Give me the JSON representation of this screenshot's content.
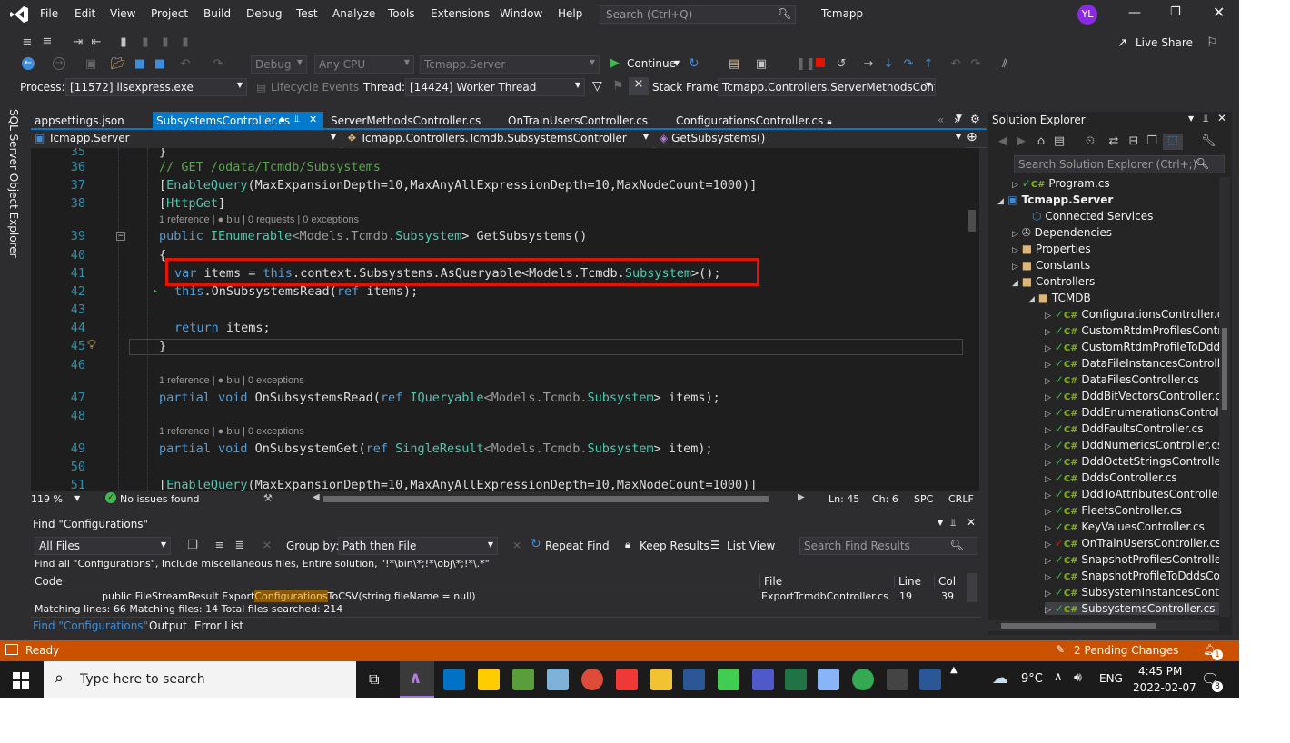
{
  "menu": {
    "items": [
      "File",
      "Edit",
      "View",
      "Project",
      "Build",
      "Debug",
      "Test",
      "Analyze",
      "Tools",
      "Extensions",
      "Window",
      "Help"
    ],
    "search_placeholder": "Search (Ctrl+Q)",
    "solution_name": "Tcmapp",
    "user_initials": "YL",
    "live_share": "Live Share"
  },
  "toolbar": {
    "config": "Debug",
    "platform": "Any CPU",
    "startup": "Tcmapp.Server",
    "continue": "Continue",
    "process_label": "Process:",
    "process": "[11572] iisexpress.exe",
    "lifecycle": "Lifecycle Events",
    "thread_label": "Thread:",
    "thread": "[14424] Worker Thread",
    "stackframe_label": "Stack Frame:",
    "stackframe": "Tcmapp.Controllers.ServerMethodsContrc"
  },
  "left_sidebar": {
    "label": "SQL Server Object Explorer"
  },
  "tabs": [
    {
      "label": "appsettings.json"
    },
    {
      "label": "SubsystemsController.cs"
    },
    {
      "label": "ServerMethodsController.cs"
    },
    {
      "label": "OnTrainUsersController.cs"
    },
    {
      "label": "ConfigurationsController.cs"
    }
  ],
  "navbar": {
    "project": "Tcmapp.Server",
    "class": "Tcmapp.Controllers.Tcmdb.SubsystemsController",
    "member": "GetSubsystems()"
  },
  "code": {
    "line_numbers": [
      "35",
      "36",
      "37",
      "38",
      "39",
      "40",
      "41",
      "42",
      "43",
      "44",
      "45",
      "46",
      "47",
      "48",
      "49",
      "50",
      "51"
    ],
    "l35": "}",
    "l36": "// GET /odata/Tcmdb/Subsystems",
    "l37_a": "[",
    "l37_b": "EnableQuery",
    "l37_c": "(MaxExpansionDepth=10,MaxAnyAllExpressionDepth=10,MaxNodeCount=1000)]",
    "l38_a": "[",
    "l38_b": "HttpGet",
    "l38_c": "]",
    "lens1": "1 reference | ● blu | 0 requests | 0 exceptions",
    "l39_a": "public ",
    "l39_b": "IEnumerable",
    "l39_c": "<Models.Tcmdb.",
    "l39_d": "Subsystem",
    "l39_e": "> GetSubsystems()",
    "l40": "{",
    "l41_a": "var",
    "l41_b": " items = ",
    "l41_c": "this",
    "l41_d": ".context.Subsystems.AsQueryable<Models.Tcmdb.",
    "l41_e": "Subsystem",
    "l41_f": ">();",
    "l42_a": "this",
    "l42_b": ".OnSubsystemsRead(",
    "l42_c": "ref",
    "l42_d": " items);",
    "l44_a": "return",
    "l44_b": " items;",
    "l45": "}",
    "lens2": "1 reference | ● blu | 0 exceptions",
    "l47_a": "partial ",
    "l47_b": "void",
    "l47_c": " OnSubsystemsRead(",
    "l47_d": "ref ",
    "l47_e": "IQueryable",
    "l47_f": "<Models.Tcmdb.",
    "l47_g": "Subsystem",
    "l47_h": "> items);",
    "lens3": "1 reference | ● blu | 0 exceptions",
    "l49_a": "partial ",
    "l49_b": "void",
    "l49_c": " OnSubsystemGet(",
    "l49_d": "ref ",
    "l49_e": "SingleResult",
    "l49_f": "<Models.Tcmdb.",
    "l49_g": "Subsystem",
    "l49_h": "> item);",
    "l51_a": "[",
    "l51_b": "EnableQuery",
    "l51_c": "(MaxExpansionDepth=10,MaxAnyAllExpressionDepth=10,MaxNodeCount=1000)]"
  },
  "editor_status": {
    "zoom": "119 %",
    "issues": "No issues found",
    "ln": "Ln: 45",
    "ch": "Ch: 6",
    "spc": "SPC",
    "crlf": "CRLF"
  },
  "find": {
    "title": "Find \"Configurations\"",
    "scope": "All Files",
    "group_by_label": "Group by:",
    "group_by": "Path then File",
    "repeat": "Repeat Find",
    "keep": "Keep Results",
    "list_view": "List View",
    "search_placeholder": "Search Find Results",
    "summary": "Find all \"Configurations\", Include miscellaneous files, Entire solution, \"!*\\bin\\*;!*\\obj\\*;!*\\.*\"",
    "col_code": "Code",
    "col_file": "File",
    "col_line": "Line",
    "col_col": "Col",
    "result_pre": "public FileStreamResult Export",
    "result_match": "Configurations",
    "result_post": "ToCSV(string fileName = null)",
    "result_file": "ExportTcmdbController.cs",
    "result_line": "19",
    "result_col": "39",
    "matching": "Matching lines: 66 Matching files: 14 Total files searched: 214",
    "bottom_tabs": [
      "Find \"Configurations\"",
      "Output",
      "Error List"
    ]
  },
  "solution_explorer": {
    "title": "Solution Explorer",
    "search_placeholder": "Search Solution Explorer (Ctrl+;)",
    "items": [
      "Program.cs",
      "Tcmapp.Server",
      "Connected Services",
      "Dependencies",
      "Properties",
      "Constants",
      "Controllers",
      "TCMDB",
      "ConfigurationsController.cs",
      "CustomRtdmProfilesContro",
      "CustomRtdmProfileToDdds",
      "DataFileInstancesController",
      "DataFilesController.cs",
      "DddBitVectorsController.cs",
      "DddEnumerationsController",
      "DddFaultsController.cs",
      "DddNumericsController.cs",
      "DddOctetStringsController.",
      "DddsController.cs",
      "DddToAttributesController.c",
      "FleetsController.cs",
      "KeyValuesController.cs",
      "OnTrainUsersController.cs",
      "SnapshotProfilesController.",
      "SnapshotProfileToDddsCon",
      "SubsystemInstancesContro",
      "SubsystemsController.cs"
    ]
  },
  "statusbar": {
    "ready": "Ready",
    "pending": "2  Pending Changes",
    "notif": "1"
  },
  "taskbar": {
    "search_placeholder": "Type here to search",
    "weather": "9°C",
    "lang": "ENG",
    "time": "4:45 PM",
    "date": "2022-02-07",
    "notif_count": "8"
  }
}
